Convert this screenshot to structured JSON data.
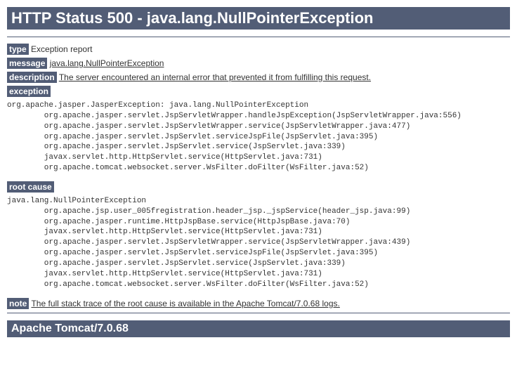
{
  "title": "HTTP Status 500 - java.lang.NullPointerException",
  "labels": {
    "type": "type",
    "message": "message",
    "description": "description",
    "exception": "exception",
    "rootCause": "root cause",
    "note": "note"
  },
  "values": {
    "type": "Exception report",
    "message": "java.lang.NullPointerException",
    "description": "The server encountered an internal error that prevented it from fulfilling this request.",
    "note": "The full stack trace of the root cause is available in the Apache Tomcat/7.0.68 logs."
  },
  "exceptionTrace": "org.apache.jasper.JasperException: java.lang.NullPointerException\n        org.apache.jasper.servlet.JspServletWrapper.handleJspException(JspServletWrapper.java:556)\n        org.apache.jasper.servlet.JspServletWrapper.service(JspServletWrapper.java:477)\n        org.apache.jasper.servlet.JspServlet.serviceJspFile(JspServlet.java:395)\n        org.apache.jasper.servlet.JspServlet.service(JspServlet.java:339)\n        javax.servlet.http.HttpServlet.service(HttpServlet.java:731)\n        org.apache.tomcat.websocket.server.WsFilter.doFilter(WsFilter.java:52)",
  "rootCauseTrace": "java.lang.NullPointerException\n        org.apache.jsp.user_005fregistration.header_jsp._jspService(header_jsp.java:99)\n        org.apache.jasper.runtime.HttpJspBase.service(HttpJspBase.java:70)\n        javax.servlet.http.HttpServlet.service(HttpServlet.java:731)\n        org.apache.jasper.servlet.JspServletWrapper.service(JspServletWrapper.java:439)\n        org.apache.jasper.servlet.JspServlet.serviceJspFile(JspServlet.java:395)\n        org.apache.jasper.servlet.JspServlet.service(JspServlet.java:339)\n        javax.servlet.http.HttpServlet.service(HttpServlet.java:731)\n        org.apache.tomcat.websocket.server.WsFilter.doFilter(WsFilter.java:52)",
  "footer": "Apache Tomcat/7.0.68"
}
